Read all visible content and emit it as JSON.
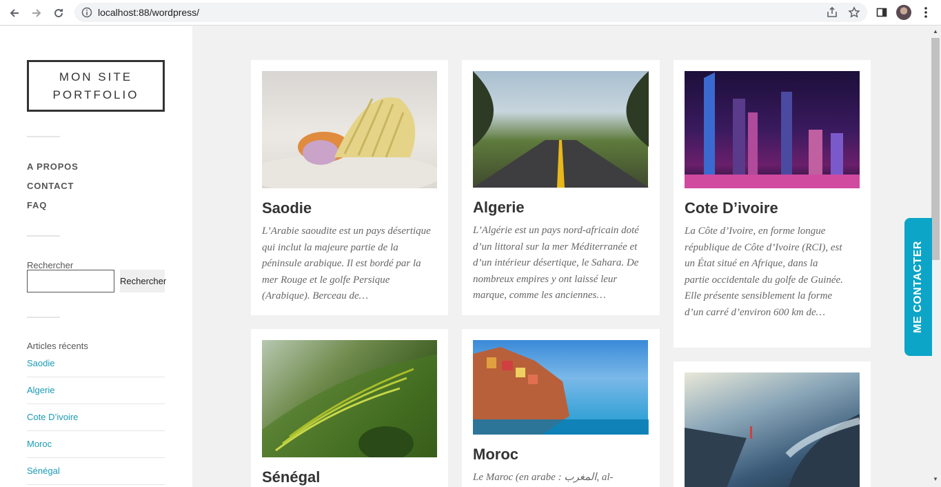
{
  "browser": {
    "url": "localhost:88/wordpress/"
  },
  "sidebar": {
    "site_title_line1": "MON SITE",
    "site_title_line2": "PORTFOLIO",
    "menu": [
      "A PROPOS",
      "CONTACT",
      "FAQ"
    ],
    "search_label": "Rechercher",
    "search_button": "Rechercher",
    "recent_title": "Articles récents",
    "recent_posts": [
      "Saodie",
      "Algerie",
      "Cote D’ivoire",
      "Moroc",
      "Sénégal"
    ]
  },
  "posts": [
    {
      "title": "Saodie",
      "excerpt": "L’Arabie saoudite est un pays désertique qui inclut la majeure partie de la péninsule arabique. Il est bordé par la mer Rouge et le golfe Persique (Arabique). Berceau de…"
    },
    {
      "title": "Algerie",
      "excerpt": "L’Algérie est un pays nord-africain doté d’un littoral sur la mer Méditerranée et d’un intérieur désertique, le Sahara. De nombreux empires y ont laissé leur marque, comme les anciennes…"
    },
    {
      "title": "Cote D’ivoire",
      "excerpt": "La Côte d’Ivoire, en forme longue république de Côte d’Ivoire (RCI), est un État situé en Afrique, dans la partie occidentale du golfe de Guinée. Elle présente sensiblement la forme d’un carré d’environ 600 km de…"
    },
    {
      "title": "Sénégal",
      "excerpt": ""
    },
    {
      "title": "Moroc",
      "excerpt": "Le Maroc (en arabe : المغرب, al-"
    }
  ],
  "contact_tab": "ME CONTACTER",
  "colors": {
    "accent": "#0ca5c8",
    "link": "#1a9ab6"
  }
}
